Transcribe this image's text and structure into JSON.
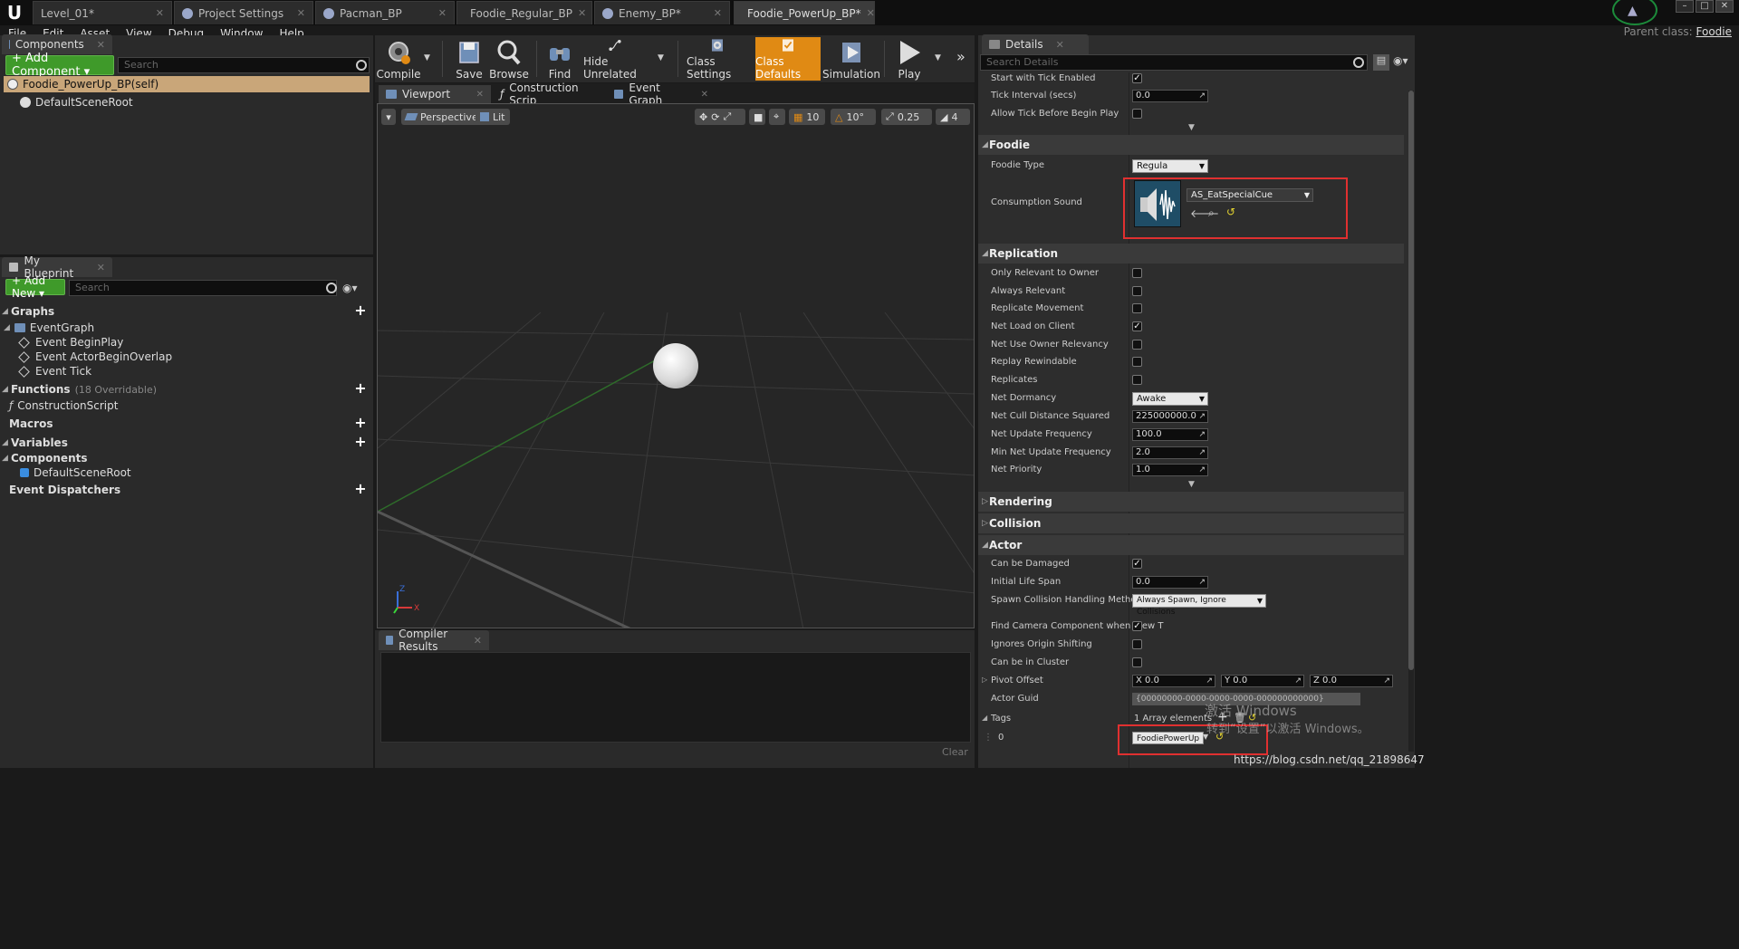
{
  "window": {
    "tabs": [
      {
        "label": "Level_01*"
      },
      {
        "label": "Project Settings"
      },
      {
        "label": "Pacman_BP"
      },
      {
        "label": "Foodie_Regular_BP"
      },
      {
        "label": "Enemy_BP*"
      },
      {
        "label": "Foodie_PowerUp_BP*"
      }
    ],
    "parent_class_label": "Parent class:",
    "parent_class_value": "Foodie"
  },
  "menu": [
    "File",
    "Edit",
    "Asset",
    "View",
    "Debug",
    "Window",
    "Help"
  ],
  "components_panel": {
    "tab_label": "Components",
    "add_button": "+ Add Component ▾",
    "search_placeholder": "Search",
    "self_item": "Foodie_PowerUp_BP(self)",
    "root_item": "DefaultSceneRoot"
  },
  "my_blueprint": {
    "tab_label": "My Blueprint",
    "add_button": "+ Add New ▾",
    "search_placeholder": "Search",
    "graphs_label": "Graphs",
    "event_graph": "EventGraph",
    "events": [
      "Event BeginPlay",
      "Event ActorBeginOverlap",
      "Event Tick"
    ],
    "functions_label": "Functions",
    "functions_overridable": "(18 Overridable)",
    "construction_script": "ConstructionScript",
    "macros_label": "Macros",
    "variables_label": "Variables",
    "components_label": "Components",
    "components_item": "DefaultSceneRoot",
    "dispatchers_label": "Event Dispatchers"
  },
  "toolbar": {
    "compile": "Compile",
    "save": "Save",
    "browse": "Browse",
    "find": "Find",
    "hide_unrelated": "Hide Unrelated",
    "class_settings": "Class Settings",
    "class_defaults": "Class Defaults",
    "simulation": "Simulation",
    "play": "Play"
  },
  "editor_tabs": {
    "viewport": "Viewport",
    "construction": "Construction Scrip",
    "event_graph": "Event Graph"
  },
  "viewport": {
    "perspective": "Perspective",
    "lit": "Lit",
    "grid_snap": "10",
    "rot_snap": "10°",
    "scale_snap": "0.25",
    "cam_speed": "4",
    "axis_x": "X",
    "axis_z": "Z"
  },
  "compiler": {
    "tab_label": "Compiler Results",
    "clear": "Clear"
  },
  "details": {
    "tab_label": "Details",
    "search_placeholder": "Search Details",
    "start_tick": "Start with Tick Enabled",
    "tick_interval": "Tick Interval (secs)",
    "tick_interval_value": "0.0",
    "allow_tick": "Allow Tick Before Begin Play",
    "foodie_cat": "Foodie",
    "foodie_type": "Foodie Type",
    "foodie_type_value": "Regula",
    "consumption_sound": "Consumption Sound",
    "sound_asset": "AS_EatSpecialCue",
    "replication_cat": "Replication",
    "replication_rows": [
      {
        "label": "Only Relevant to Owner"
      },
      {
        "label": "Always Relevant"
      },
      {
        "label": "Replicate Movement"
      },
      {
        "label": "Net Load on Client"
      },
      {
        "label": "Net Use Owner Relevancy"
      },
      {
        "label": "Replay Rewindable"
      },
      {
        "label": "Replicates"
      }
    ],
    "net_dormancy": "Net Dormancy",
    "net_dormancy_value": "Awake",
    "net_cull": "Net Cull Distance Squared",
    "net_cull_value": "225000000.0",
    "net_update": "Net Update Frequency",
    "net_update_value": "100.0",
    "min_net_update": "Min Net Update Frequency",
    "min_net_update_value": "2.0",
    "net_priority": "Net Priority",
    "net_priority_value": "1.0",
    "rendering_cat": "Rendering",
    "collision_cat": "Collision",
    "actor_cat": "Actor",
    "can_be_damaged": "Can be Damaged",
    "initial_life_span": "Initial Life Span",
    "initial_life_span_value": "0.0",
    "spawn_collision": "Spawn Collision Handling Method",
    "spawn_collision_value": "Always Spawn, Ignore Collisions",
    "find_camera": "Find Camera Component when View T",
    "ignores_origin": "Ignores Origin Shifting",
    "can_be_cluster": "Can be in Cluster",
    "pivot_offset": "Pivot Offset",
    "pivot_x": "X  0.0",
    "pivot_y": "Y  0.0",
    "pivot_z": "Z  0.0",
    "actor_guid": "Actor Guid",
    "actor_guid_value": "{00000000-0000-0000-0000-000000000000}",
    "tags": "Tags",
    "tags_count": "1 Array elements",
    "tag_index": "0",
    "tag_value": "FoodiePowerUp"
  },
  "overlay": {
    "windows_watermark_1": "激活 Windows",
    "windows_watermark_2": "转到“设置”以激活 Windows。",
    "csdn": "https://blog.csdn.net/qq_21898647"
  },
  "colors": {
    "accent_orange": "#e08a14",
    "green_button": "#3f9a2a",
    "highlight_red": "#e03030",
    "self_row": "#c9a679"
  }
}
